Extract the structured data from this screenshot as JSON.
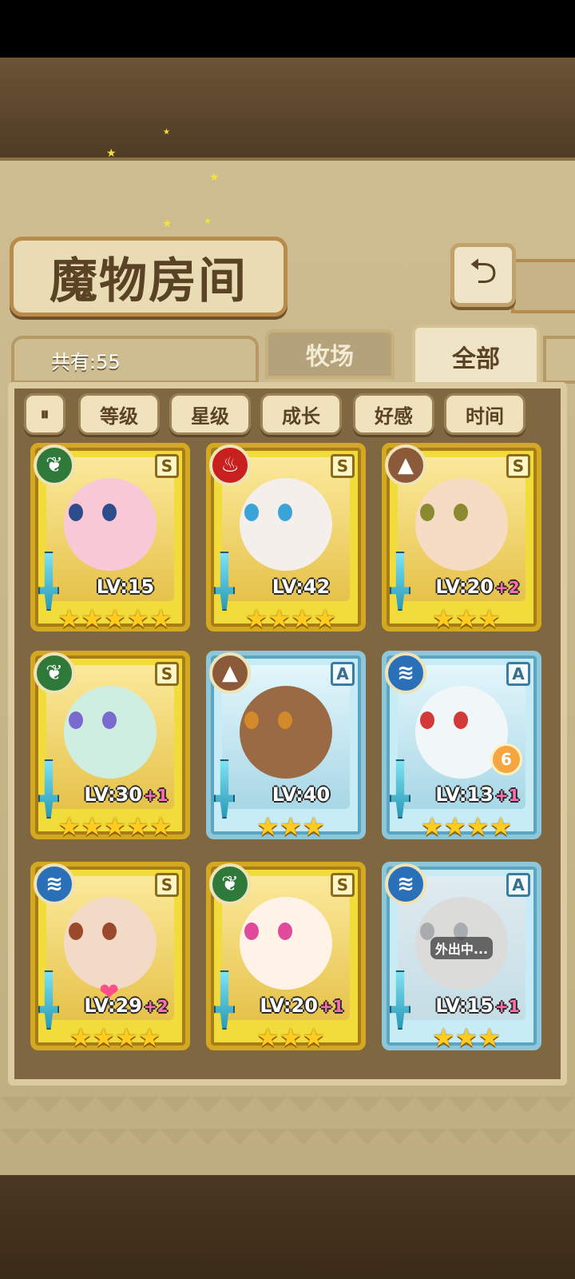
{
  "screen": {
    "title": "魔物房间",
    "back_icon": "return-arrow-icon",
    "count_label": "共有:55"
  },
  "tabs": [
    {
      "label": "牧场",
      "active": false
    },
    {
      "label": "全部",
      "active": true
    }
  ],
  "filters": {
    "toggle_icon": "sort-toggle-icon",
    "buttons": [
      "等级",
      "星级",
      "成长",
      "好感",
      "时间"
    ]
  },
  "colors": {
    "rank_S": "#f2dc3c",
    "rank_A": "#c8ecf6",
    "element_leaf": "#2f7a3a",
    "element_fire": "#c8201f",
    "element_earth": "#8a5a3a",
    "element_water": "#2a70b8",
    "level_bonus": "#ff6fb0"
  },
  "monsters": [
    {
      "rank": "S",
      "element": "leaf-icon",
      "level": "LV:15",
      "bonus": "",
      "stars": 5,
      "status": ""
    },
    {
      "rank": "S",
      "element": "fire-icon",
      "level": "LV:42",
      "bonus": "",
      "stars": 4,
      "status": ""
    },
    {
      "rank": "S",
      "element": "earth-icon",
      "level": "LV:20",
      "bonus": "+2",
      "stars": 3,
      "status": ""
    },
    {
      "rank": "S",
      "element": "leaf-icon",
      "level": "LV:30",
      "bonus": "+1",
      "stars": 5,
      "status": ""
    },
    {
      "rank": "A",
      "element": "earth-icon",
      "level": "LV:40",
      "bonus": "",
      "stars": 3,
      "status": ""
    },
    {
      "rank": "A",
      "element": "water-icon",
      "level": "LV:13",
      "bonus": "+1",
      "stars": 4,
      "status": "",
      "badge": "6"
    },
    {
      "rank": "S",
      "element": "water-icon",
      "level": "LV:29",
      "bonus": "+2",
      "stars": 4,
      "status": ""
    },
    {
      "rank": "S",
      "element": "leaf-icon",
      "level": "LV:20",
      "bonus": "+1",
      "stars": 3,
      "status": ""
    },
    {
      "rank": "A",
      "element": "water-icon",
      "level": "LV:15",
      "bonus": "+1",
      "stars": 3,
      "status": "外出中..."
    }
  ]
}
